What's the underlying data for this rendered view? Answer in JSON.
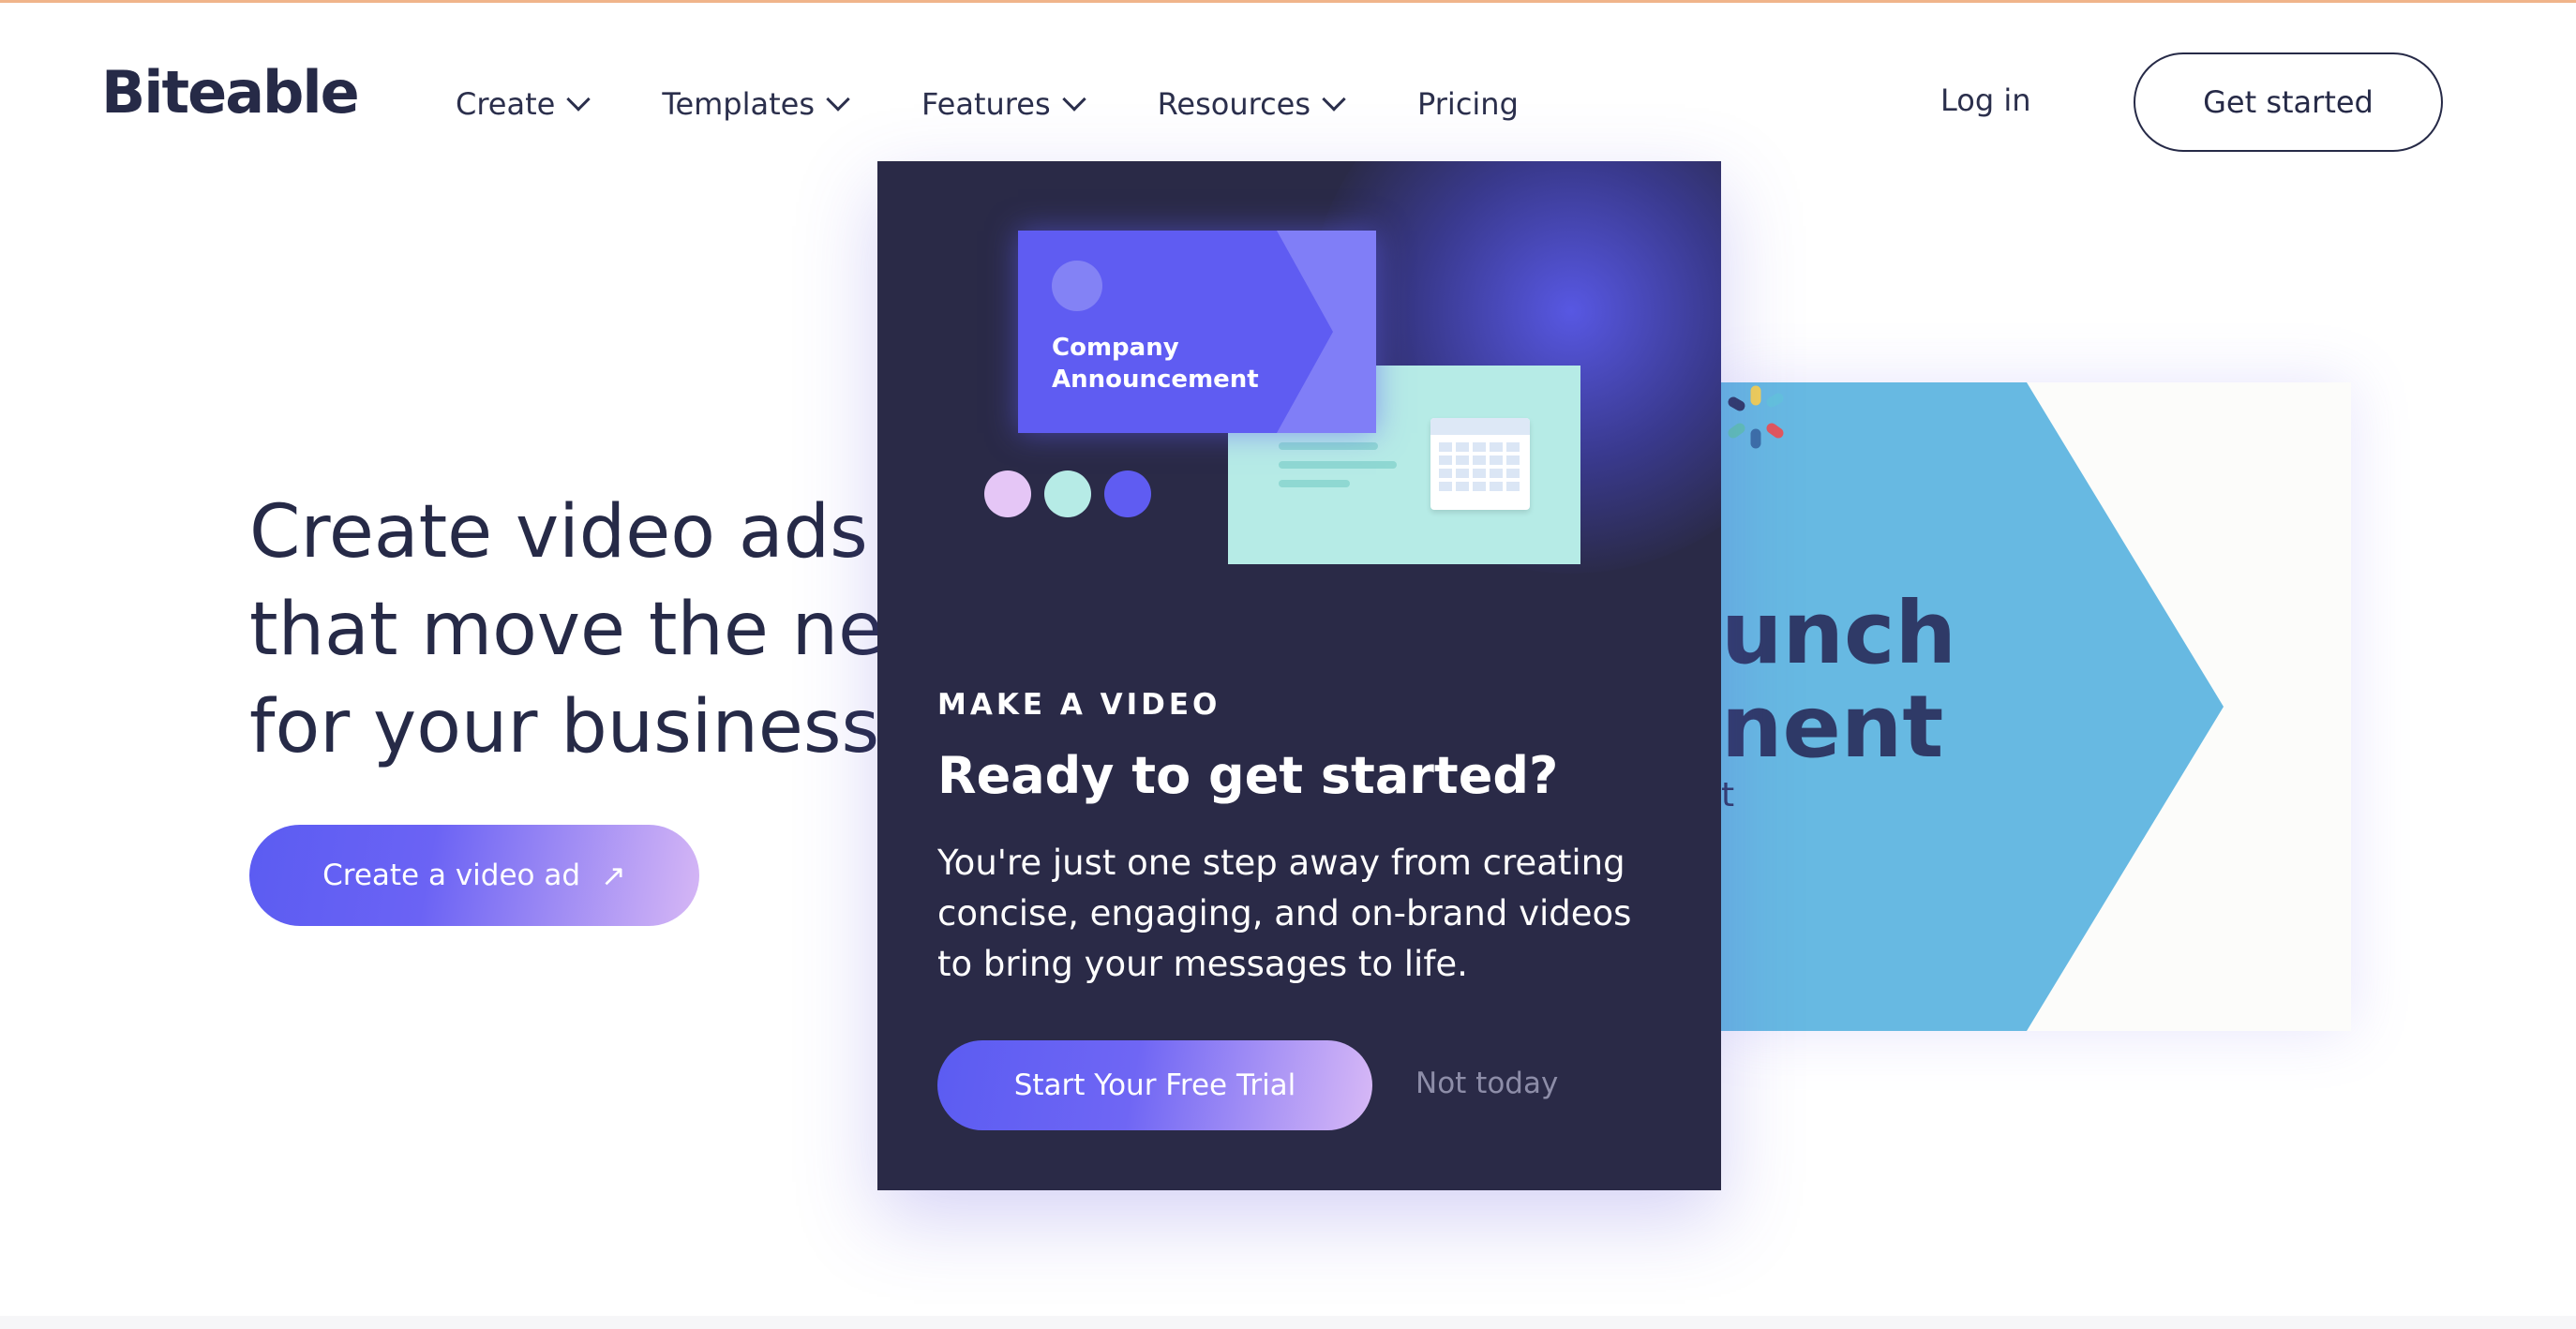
{
  "header": {
    "logo": "Biteable",
    "nav": [
      {
        "label": "Create",
        "has_dropdown": true
      },
      {
        "label": "Templates",
        "has_dropdown": true
      },
      {
        "label": "Features",
        "has_dropdown": true
      },
      {
        "label": "Resources",
        "has_dropdown": true
      },
      {
        "label": "Pricing",
        "has_dropdown": false
      }
    ],
    "login": "Log in",
    "get_started": "Get started"
  },
  "hero": {
    "title_lines": [
      "Create video ads",
      "that move the nee",
      "for your business"
    ],
    "cta": "Create a video ad",
    "cta_icon": "arrow-up-right-icon"
  },
  "background_card": {
    "title_lines": [
      "unch",
      "nent"
    ],
    "subtitle": "t",
    "colors": {
      "chevron": "#67b9e2",
      "title": "#2f3a67"
    }
  },
  "modal": {
    "illustration": {
      "card_label_lines": [
        "Company",
        "Announcement"
      ],
      "dot_colors": [
        "#e5c6f6",
        "#b6ebe6",
        "#5f5cf2"
      ]
    },
    "eyebrow": "MAKE A VIDEO",
    "title": "Ready to get started?",
    "body_lines": [
      "You're just one step away from creating",
      "concise, engaging, and on-brand videos",
      "to bring your messages to life."
    ],
    "primary_cta": "Start Your Free Trial",
    "secondary_cta": "Not today",
    "colors": {
      "background": "#2a2a47",
      "accent": "#5f5cf2"
    }
  }
}
